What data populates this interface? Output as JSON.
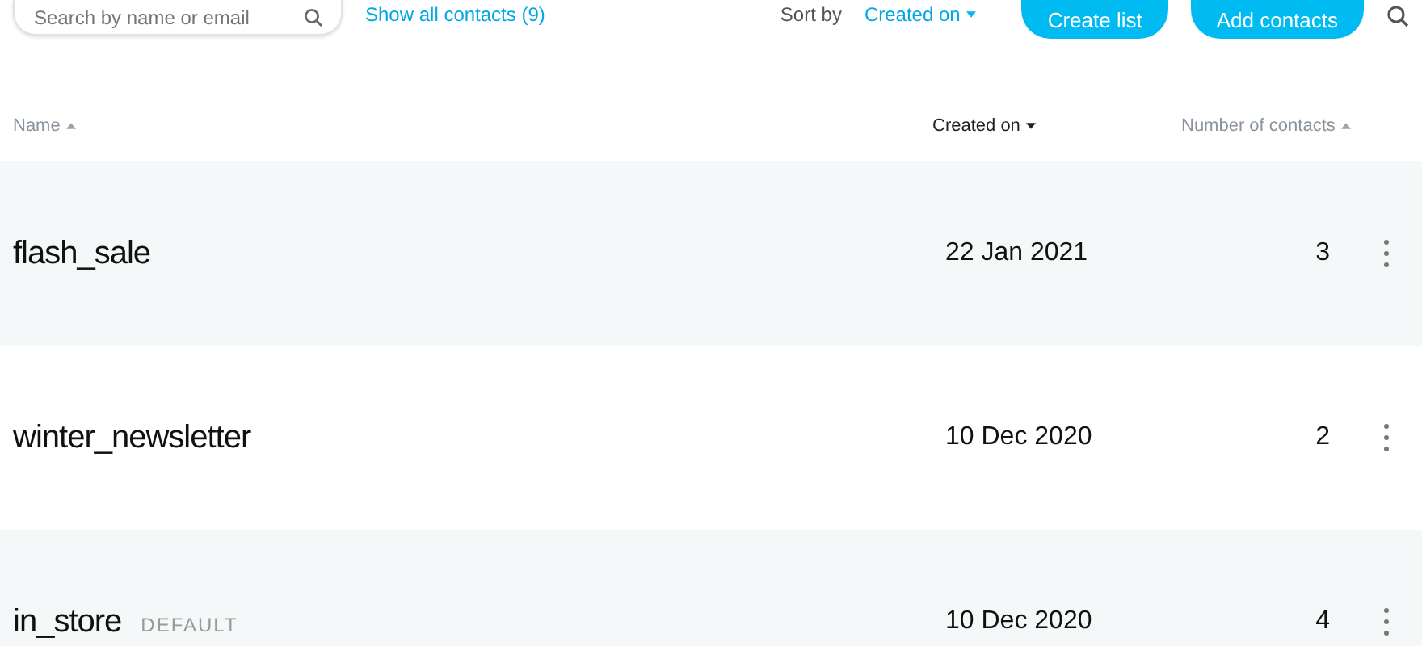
{
  "toolbar": {
    "search": {
      "placeholder": "Search by name or email"
    },
    "show_all_link": "Show all contacts (9)",
    "sort_label": "Sort by",
    "sort_value": "Created on",
    "buttons": [
      "Create list",
      "Add contacts"
    ]
  },
  "table": {
    "columns": [
      {
        "label": "Name",
        "ascending": true,
        "selected": false
      },
      {
        "label": "Created on",
        "ascending": false,
        "selected": true
      },
      {
        "label": "Number of contacts",
        "ascending": true,
        "selected": false
      }
    ],
    "rows": [
      {
        "name": "flash_sale",
        "created": "22 Jan 2021",
        "count": "3"
      },
      {
        "name": "winter_newsletter",
        "created": "10 Dec 2020",
        "count": "2"
      },
      {
        "name": "in_store",
        "badge": "DEFAULT",
        "created": "10 Dec 2020",
        "count": "4"
      }
    ]
  }
}
